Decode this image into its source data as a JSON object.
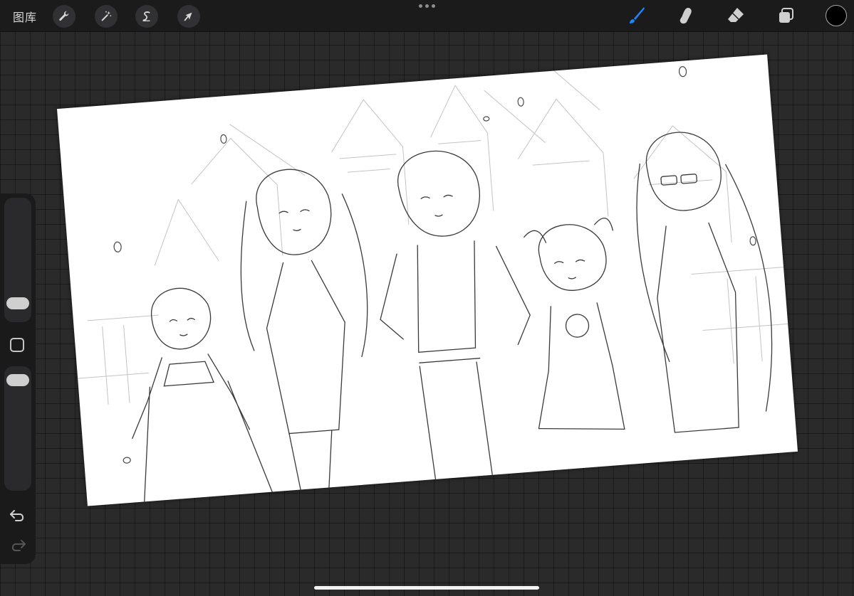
{
  "toolbar": {
    "gallery_label": "图库",
    "left_tools": [
      {
        "icon": "wrench-icon"
      },
      {
        "icon": "magic-wand-icon"
      },
      {
        "icon": "selection-icon"
      },
      {
        "icon": "transform-arrow-icon"
      }
    ],
    "right_tools": [
      {
        "icon": "brush-icon",
        "active": true,
        "color": "#1e86ff"
      },
      {
        "icon": "smudge-icon"
      },
      {
        "icon": "eraser-icon"
      },
      {
        "icon": "layers-icon"
      }
    ],
    "current_color": "#000000"
  },
  "sidebar": {
    "brush_size_icon": "brush-size-slider",
    "modify_icon": "modify-square-icon",
    "opacity_icon": "opacity-slider",
    "undo_icon": "undo-arrow-icon",
    "redo_icon": "redo-arrow-icon"
  },
  "canvas": {
    "background": "#ffffff",
    "stroke_color": "#3a3a3a"
  }
}
